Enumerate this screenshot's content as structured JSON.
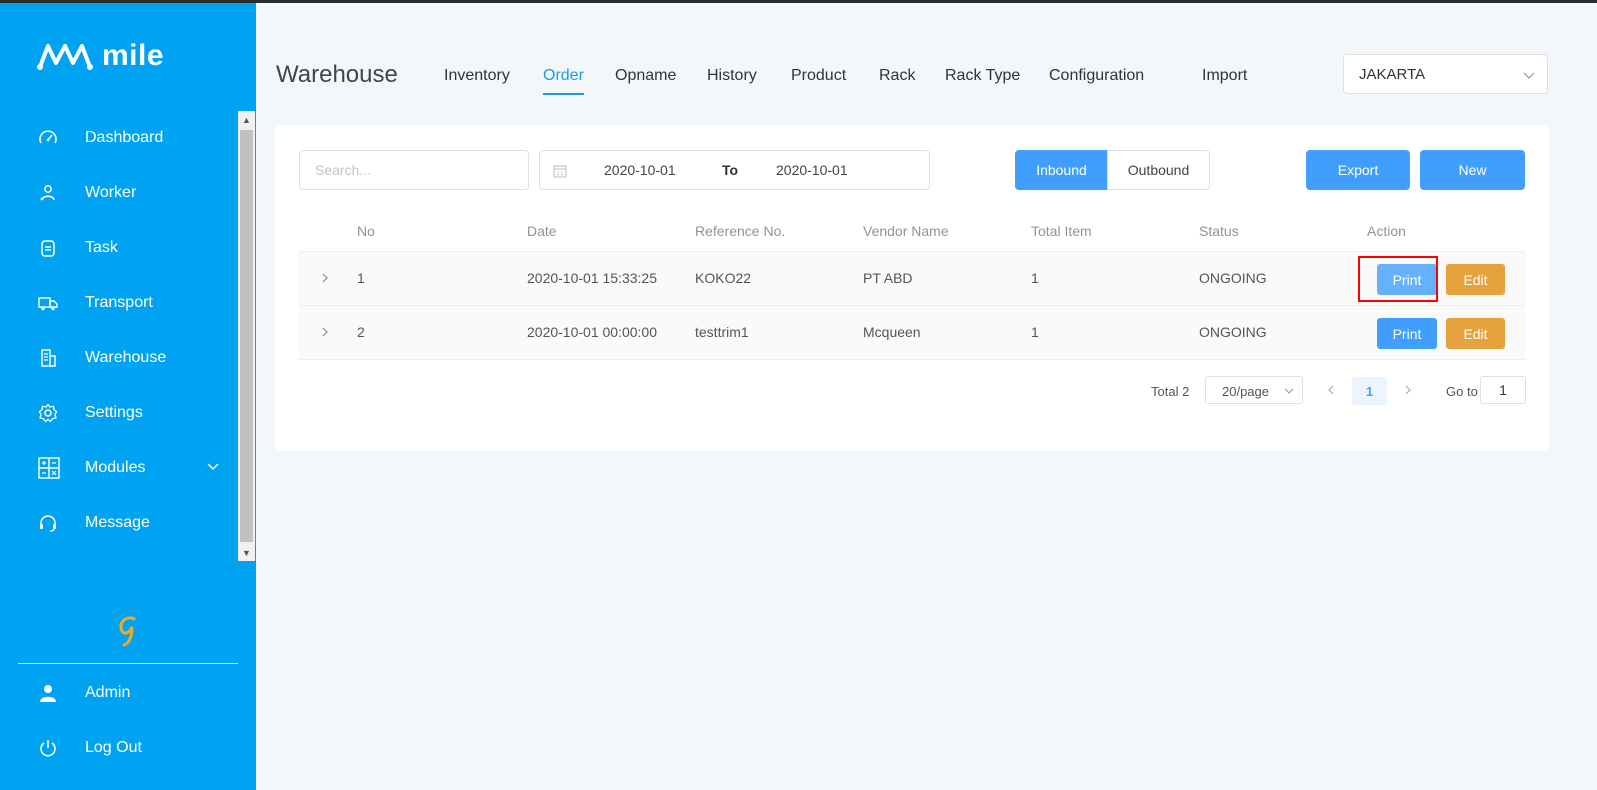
{
  "app": {
    "logo_text": "mile"
  },
  "sidebar": {
    "items": [
      {
        "label": "Dashboard",
        "icon": "gauge-icon"
      },
      {
        "label": "Worker",
        "icon": "user-icon"
      },
      {
        "label": "Task",
        "icon": "clipboard-icon"
      },
      {
        "label": "Transport",
        "icon": "truck-icon"
      },
      {
        "label": "Warehouse",
        "icon": "building-icon"
      },
      {
        "label": "Settings",
        "icon": "gear-icon"
      },
      {
        "label": "Modules",
        "icon": "modules-icon",
        "has_children": true
      },
      {
        "label": "Message",
        "icon": "headset-icon"
      }
    ],
    "bottom": [
      {
        "label": "Admin",
        "icon": "person-icon"
      },
      {
        "label": "Log Out",
        "icon": "power-icon"
      }
    ]
  },
  "header": {
    "title": "Warehouse",
    "tabs": [
      {
        "label": "Inventory",
        "active": false
      },
      {
        "label": "Order",
        "active": true
      },
      {
        "label": "Opname",
        "active": false
      },
      {
        "label": "History",
        "active": false
      },
      {
        "label": "Product",
        "active": false
      },
      {
        "label": "Rack",
        "active": false
      },
      {
        "label": "Rack Type",
        "active": false
      },
      {
        "label": "Configuration",
        "active": false
      },
      {
        "label": "Import",
        "active": false
      }
    ],
    "location": "JAKARTA"
  },
  "filters": {
    "search_placeholder": "Search...",
    "date_from": "2020-10-01",
    "date_sep": "To",
    "date_to": "2020-10-01",
    "inbound_label": "Inbound",
    "outbound_label": "Outbound",
    "export_label": "Export",
    "new_label": "New"
  },
  "table": {
    "columns": [
      "No",
      "Date",
      "Reference No.",
      "Vendor Name",
      "Total Item",
      "Status",
      "Action"
    ],
    "rows": [
      {
        "no": "1",
        "date": "2020-10-01 15:33:25",
        "ref": "KOKO22",
        "vendor": "PT ABD",
        "total": "1",
        "status": "ONGOING",
        "print": "Print",
        "edit": "Edit"
      },
      {
        "no": "2",
        "date": "2020-10-01 00:00:00",
        "ref": "testtrim1",
        "vendor": "Mcqueen",
        "total": "1",
        "status": "ONGOING",
        "print": "Print",
        "edit": "Edit"
      }
    ]
  },
  "pagination": {
    "total": "Total 2",
    "page_size": "20/page",
    "current": "1",
    "goto_label": "Go to",
    "goto_value": "1"
  },
  "colors": {
    "sidebar": "#00a3f2",
    "primary": "#409eff",
    "warning": "#e6a23c",
    "highlight": "#ff0000"
  }
}
